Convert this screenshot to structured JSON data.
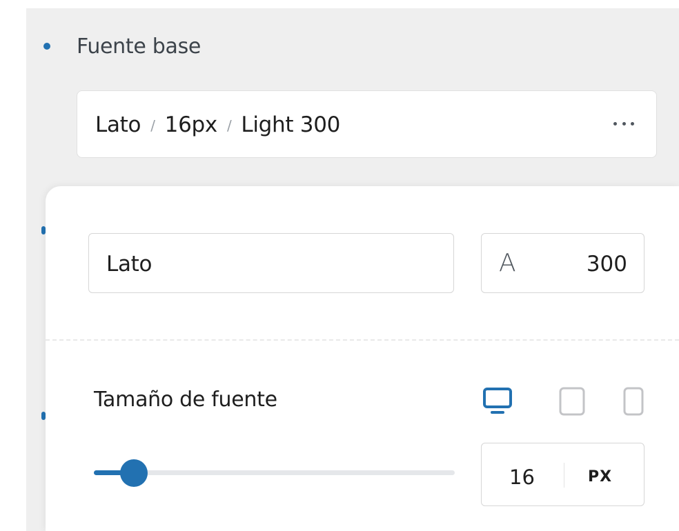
{
  "section": {
    "label": "Fuente base"
  },
  "summary": {
    "family": "Lato",
    "size": "16px",
    "weight": "Light 300",
    "separator": "/"
  },
  "typography": {
    "font_family_value": "Lato",
    "weight_icon_glyph": "A",
    "weight_value": "300"
  },
  "font_size": {
    "label": "Tamaño de fuente",
    "value": "16",
    "unit": "PX",
    "slider_level": 0.11,
    "devices": [
      {
        "name": "desktop",
        "icon": "desktop-icon",
        "active": true
      },
      {
        "name": "tablet",
        "icon": "tablet-icon",
        "active": false
      },
      {
        "name": "mobile",
        "icon": "mobile-icon",
        "active": false
      }
    ]
  },
  "colors": {
    "accent": "#2271b1",
    "inactive_icon": "#c3c4c7",
    "panel_bg": "#efefef"
  }
}
